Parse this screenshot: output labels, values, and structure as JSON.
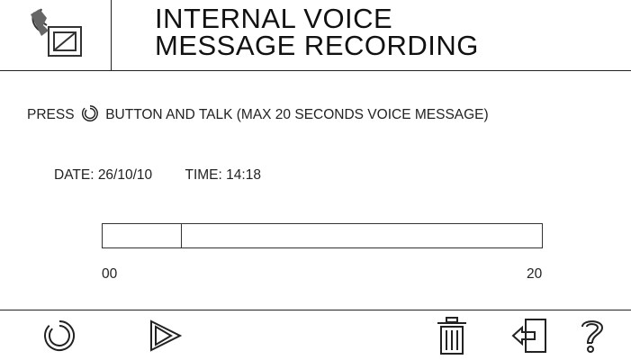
{
  "header": {
    "icon": "handset-intercom-icon",
    "title_line1": "INTERNAL VOICE",
    "title_line2": "MESSAGE RECORDING"
  },
  "instruction": {
    "before_icon": "PRESS",
    "icon": "record-icon",
    "after_icon": "BUTTON AND TALK (MAX 20 SECONDS VOICE MESSAGE)"
  },
  "datetime": {
    "date_label": "DATE:",
    "date_value": "26/10/10",
    "time_label": "TIME:",
    "time_value": "14:18"
  },
  "progress": {
    "value_fraction": 0.18,
    "min_label": "00",
    "max_label": "20"
  },
  "toolbar": {
    "buttons": [
      {
        "icon": "record-icon"
      },
      {
        "icon": "play-icon"
      },
      {
        "icon": "trash-icon"
      },
      {
        "icon": "exit-icon"
      },
      {
        "icon": "help-icon"
      }
    ]
  }
}
